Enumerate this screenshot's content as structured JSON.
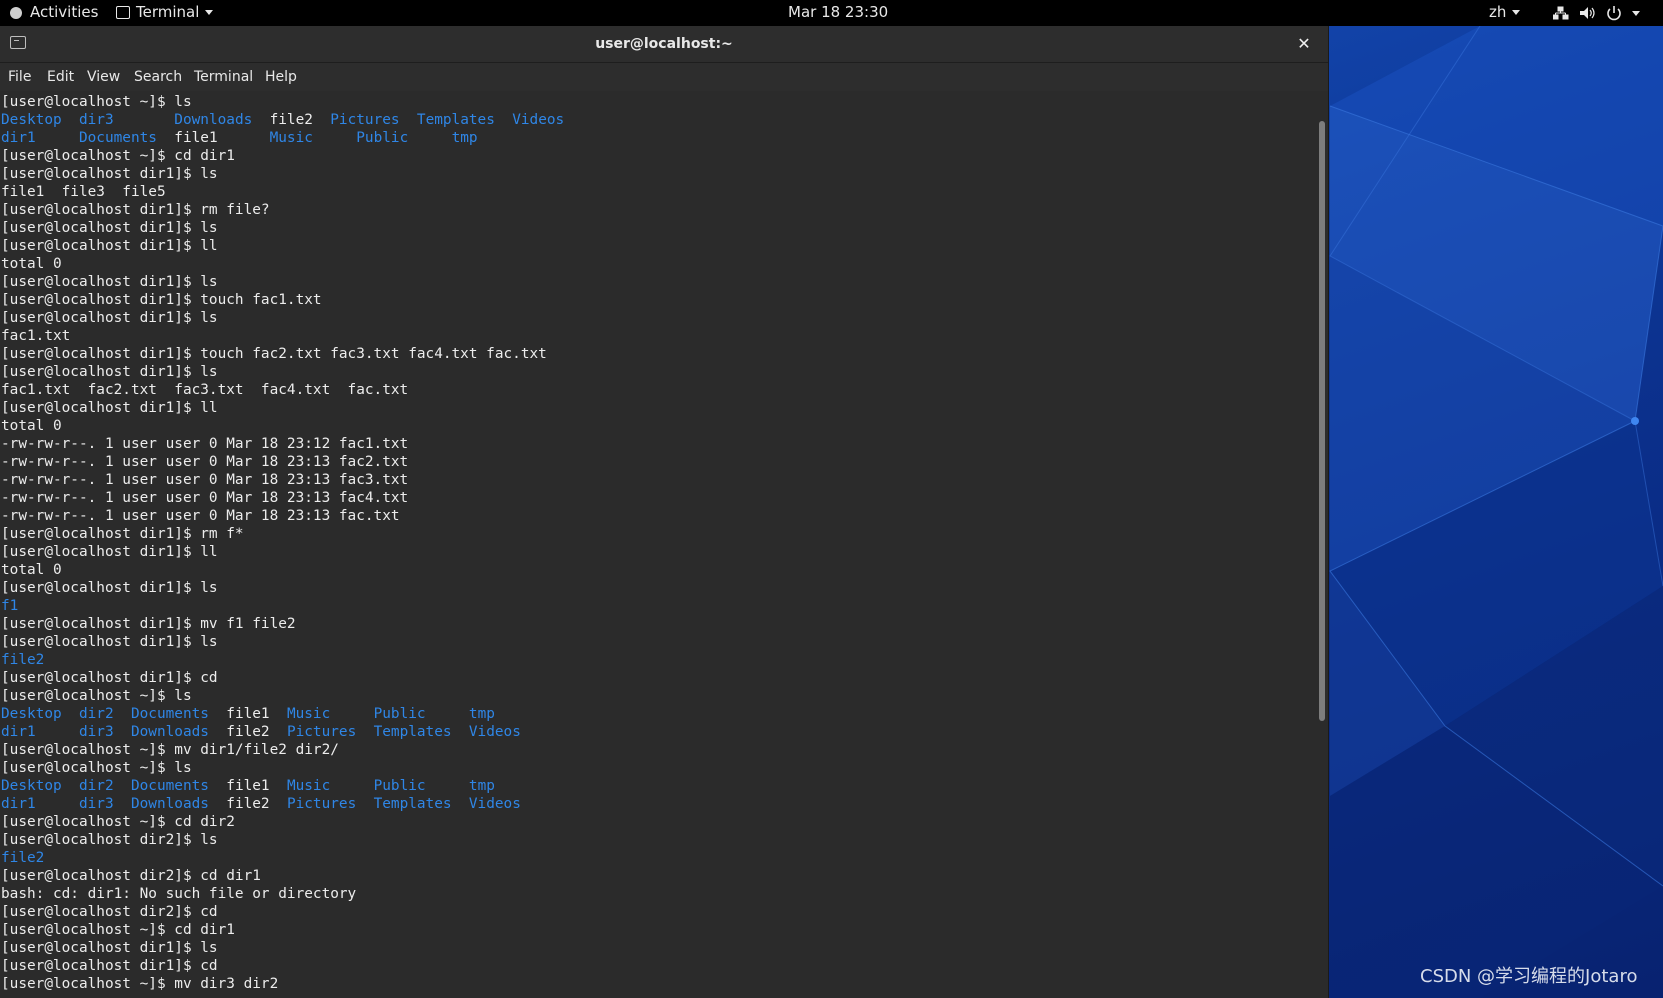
{
  "topbar": {
    "activities": "Activities",
    "app_menu": "Terminal",
    "clock": "Mar 18  23:30",
    "input_source": "zh"
  },
  "window": {
    "title": "user@localhost:~",
    "close_glyph": "✕"
  },
  "menubar": {
    "items": [
      "File",
      "Edit",
      "View",
      "Search",
      "Terminal",
      "Help"
    ]
  },
  "terminal": {
    "lines": [
      [
        {
          "t": "[user@localhost ~]$ ls"
        }
      ],
      [
        {
          "t": "Desktop",
          "c": "dir"
        },
        {
          "t": "  "
        },
        {
          "t": "dir3",
          "c": "dir"
        },
        {
          "t": "       "
        },
        {
          "t": "Downloads",
          "c": "dir"
        },
        {
          "t": "  file2  "
        },
        {
          "t": "Pictures",
          "c": "dir"
        },
        {
          "t": "  "
        },
        {
          "t": "Templates",
          "c": "dir"
        },
        {
          "t": "  "
        },
        {
          "t": "Videos",
          "c": "dir"
        }
      ],
      [
        {
          "t": "dir1",
          "c": "dir"
        },
        {
          "t": "     "
        },
        {
          "t": "Documents",
          "c": "dir"
        },
        {
          "t": "  file1      "
        },
        {
          "t": "Music",
          "c": "dir"
        },
        {
          "t": "     "
        },
        {
          "t": "Public",
          "c": "dir"
        },
        {
          "t": "     "
        },
        {
          "t": "tmp",
          "c": "dir"
        }
      ],
      [
        {
          "t": "[user@localhost ~]$ cd dir1"
        }
      ],
      [
        {
          "t": "[user@localhost dir1]$ ls"
        }
      ],
      [
        {
          "t": "file1  file3  file5"
        }
      ],
      [
        {
          "t": "[user@localhost dir1]$ rm file?"
        }
      ],
      [
        {
          "t": "[user@localhost dir1]$ ls"
        }
      ],
      [
        {
          "t": "[user@localhost dir1]$ ll"
        }
      ],
      [
        {
          "t": "total 0"
        }
      ],
      [
        {
          "t": "[user@localhost dir1]$ ls"
        }
      ],
      [
        {
          "t": "[user@localhost dir1]$ touch fac1.txt"
        }
      ],
      [
        {
          "t": "[user@localhost dir1]$ ls"
        }
      ],
      [
        {
          "t": "fac1.txt"
        }
      ],
      [
        {
          "t": "[user@localhost dir1]$ touch fac2.txt fac3.txt fac4.txt fac.txt"
        }
      ],
      [
        {
          "t": "[user@localhost dir1]$ ls"
        }
      ],
      [
        {
          "t": "fac1.txt  fac2.txt  fac3.txt  fac4.txt  fac.txt"
        }
      ],
      [
        {
          "t": "[user@localhost dir1]$ ll"
        }
      ],
      [
        {
          "t": "total 0"
        }
      ],
      [
        {
          "t": "-rw-rw-r--. 1 user user 0 Mar 18 23:12 fac1.txt"
        }
      ],
      [
        {
          "t": "-rw-rw-r--. 1 user user 0 Mar 18 23:13 fac2.txt"
        }
      ],
      [
        {
          "t": "-rw-rw-r--. 1 user user 0 Mar 18 23:13 fac3.txt"
        }
      ],
      [
        {
          "t": "-rw-rw-r--. 1 user user 0 Mar 18 23:13 fac4.txt"
        }
      ],
      [
        {
          "t": "-rw-rw-r--. 1 user user 0 Mar 18 23:13 fac.txt"
        }
      ],
      [
        {
          "t": "[user@localhost dir1]$ rm f*"
        }
      ],
      [
        {
          "t": "[user@localhost dir1]$ ll"
        }
      ],
      [
        {
          "t": "total 0"
        }
      ],
      [
        {
          "t": "[user@localhost dir1]$ ls"
        }
      ],
      [
        {
          "t": "f1",
          "c": "dir"
        }
      ],
      [
        {
          "t": "[user@localhost dir1]$ mv f1 file2"
        }
      ],
      [
        {
          "t": "[user@localhost dir1]$ ls"
        }
      ],
      [
        {
          "t": "file2",
          "c": "dir"
        }
      ],
      [
        {
          "t": "[user@localhost dir1]$ cd"
        }
      ],
      [
        {
          "t": "[user@localhost ~]$ ls"
        }
      ],
      [
        {
          "t": "Desktop",
          "c": "dir"
        },
        {
          "t": "  "
        },
        {
          "t": "dir2",
          "c": "dir"
        },
        {
          "t": "  "
        },
        {
          "t": "Documents",
          "c": "dir"
        },
        {
          "t": "  file1  "
        },
        {
          "t": "Music",
          "c": "dir"
        },
        {
          "t": "     "
        },
        {
          "t": "Public",
          "c": "dir"
        },
        {
          "t": "     "
        },
        {
          "t": "tmp",
          "c": "dir"
        }
      ],
      [
        {
          "t": "dir1",
          "c": "dir"
        },
        {
          "t": "     "
        },
        {
          "t": "dir3",
          "c": "dir"
        },
        {
          "t": "  "
        },
        {
          "t": "Downloads",
          "c": "dir"
        },
        {
          "t": "  file2  "
        },
        {
          "t": "Pictures",
          "c": "dir"
        },
        {
          "t": "  "
        },
        {
          "t": "Templates",
          "c": "dir"
        },
        {
          "t": "  "
        },
        {
          "t": "Videos",
          "c": "dir"
        }
      ],
      [
        {
          "t": "[user@localhost ~]$ mv dir1/file2 dir2/"
        }
      ],
      [
        {
          "t": "[user@localhost ~]$ ls"
        }
      ],
      [
        {
          "t": "Desktop",
          "c": "dir"
        },
        {
          "t": "  "
        },
        {
          "t": "dir2",
          "c": "dir"
        },
        {
          "t": "  "
        },
        {
          "t": "Documents",
          "c": "dir"
        },
        {
          "t": "  file1  "
        },
        {
          "t": "Music",
          "c": "dir"
        },
        {
          "t": "     "
        },
        {
          "t": "Public",
          "c": "dir"
        },
        {
          "t": "     "
        },
        {
          "t": "tmp",
          "c": "dir"
        }
      ],
      [
        {
          "t": "dir1",
          "c": "dir"
        },
        {
          "t": "     "
        },
        {
          "t": "dir3",
          "c": "dir"
        },
        {
          "t": "  "
        },
        {
          "t": "Downloads",
          "c": "dir"
        },
        {
          "t": "  file2  "
        },
        {
          "t": "Pictures",
          "c": "dir"
        },
        {
          "t": "  "
        },
        {
          "t": "Templates",
          "c": "dir"
        },
        {
          "t": "  "
        },
        {
          "t": "Videos",
          "c": "dir"
        }
      ],
      [
        {
          "t": "[user@localhost ~]$ cd dir2"
        }
      ],
      [
        {
          "t": "[user@localhost dir2]$ ls"
        }
      ],
      [
        {
          "t": "file2",
          "c": "dir"
        }
      ],
      [
        {
          "t": "[user@localhost dir2]$ cd dir1"
        }
      ],
      [
        {
          "t": "bash: cd: dir1: No such file or directory"
        }
      ],
      [
        {
          "t": "[user@localhost dir2]$ cd"
        }
      ],
      [
        {
          "t": "[user@localhost ~]$ cd dir1"
        }
      ],
      [
        {
          "t": "[user@localhost dir1]$ ls"
        }
      ],
      [
        {
          "t": "[user@localhost dir1]$ cd"
        }
      ],
      [
        {
          "t": "[user@localhost ~]$ mv dir3 dir2"
        }
      ]
    ]
  },
  "colors": {
    "directory": "#2f86e6",
    "text": "#ececec",
    "terminal_bg": "#2b2b2b"
  },
  "icons": [
    "gnome-foot-icon",
    "terminal-app-icon",
    "new-tab-icon",
    "close-icon",
    "network-icon",
    "volume-icon",
    "power-icon"
  ],
  "watermark": "CSDN @学习编程的Jotaro"
}
